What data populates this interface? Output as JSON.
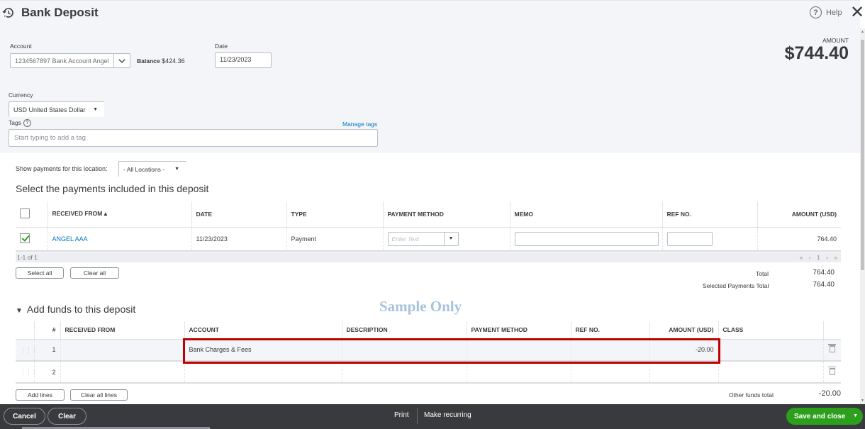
{
  "header": {
    "title": "Bank Deposit",
    "title_icon": "recent-transactions-icon",
    "help_label": "Help",
    "help_icon": "question-circle-icon",
    "close_icon": "close-icon",
    "amount_label": "AMOUNT",
    "amount_value": "$744.40"
  },
  "form": {
    "account_label": "Account",
    "account_value": "1234567897 Bank Account Angel",
    "balance_label": "Balance",
    "balance_value": "$424.36",
    "date_label": "Date",
    "date_value": "11/23/2023",
    "currency_label": "Currency",
    "currency_value": "USD United States Dollar",
    "tags_label": "Tags",
    "manage_tags": "Manage tags",
    "tags_placeholder": "Start typing to add a tag"
  },
  "location": {
    "label": "Show payments for this location:",
    "value": "- All Locations -"
  },
  "payments": {
    "section_title": "Select the payments included in this deposit",
    "columns": [
      "RECEIVED FROM ▴",
      "DATE",
      "TYPE",
      "PAYMENT METHOD",
      "MEMO",
      "REF NO.",
      "AMOUNT (USD)"
    ],
    "rows": [
      {
        "checked": true,
        "received_from": "ANGEL AAA",
        "date": "11/23/2023",
        "type": "Payment",
        "payment_method_placeholder": "Enter Text",
        "memo": "",
        "ref_no": "",
        "amount": "764.40"
      }
    ],
    "pagination_text": "1-1 of 1",
    "pager": {
      "first": "«",
      "prev": "‹",
      "page": "1",
      "next": "›",
      "last": "»"
    },
    "select_all_label": "Select all",
    "clear_all_label": "Clear all",
    "total_label": "Total",
    "total_value": "764.40",
    "selected_total_label": "Selected Payments Total",
    "selected_total_value": "764.40"
  },
  "watermark": "Sample Only",
  "funds": {
    "section_title": "Add funds to this deposit",
    "columns": [
      "#",
      "RECEIVED FROM",
      "ACCOUNT",
      "DESCRIPTION",
      "PAYMENT METHOD",
      "REF NO.",
      "AMOUNT (USD)",
      "CLASS"
    ],
    "rows": [
      {
        "num": "1",
        "received_from": "",
        "account": "Bank Charges & Fees",
        "description": "",
        "payment_method": "",
        "ref_no": "",
        "amount": "-20.00",
        "class": ""
      },
      {
        "num": "2",
        "received_from": "",
        "account": "",
        "description": "",
        "payment_method": "",
        "ref_no": "",
        "amount": "",
        "class": ""
      }
    ],
    "add_lines_label": "Add lines",
    "clear_all_lines_label": "Clear all lines",
    "other_total_label": "Other funds total",
    "other_total_value": "-20.00"
  },
  "footer": {
    "cancel_label": "Cancel",
    "clear_label": "Clear",
    "print_label": "Print",
    "make_recurring_label": "Make recurring",
    "save_label": "Save and close"
  },
  "colors": {
    "primary_green": "#2ca01c",
    "link_blue": "#0077c5",
    "highlight_red": "#c00000",
    "footer_bg": "#393a3d"
  }
}
